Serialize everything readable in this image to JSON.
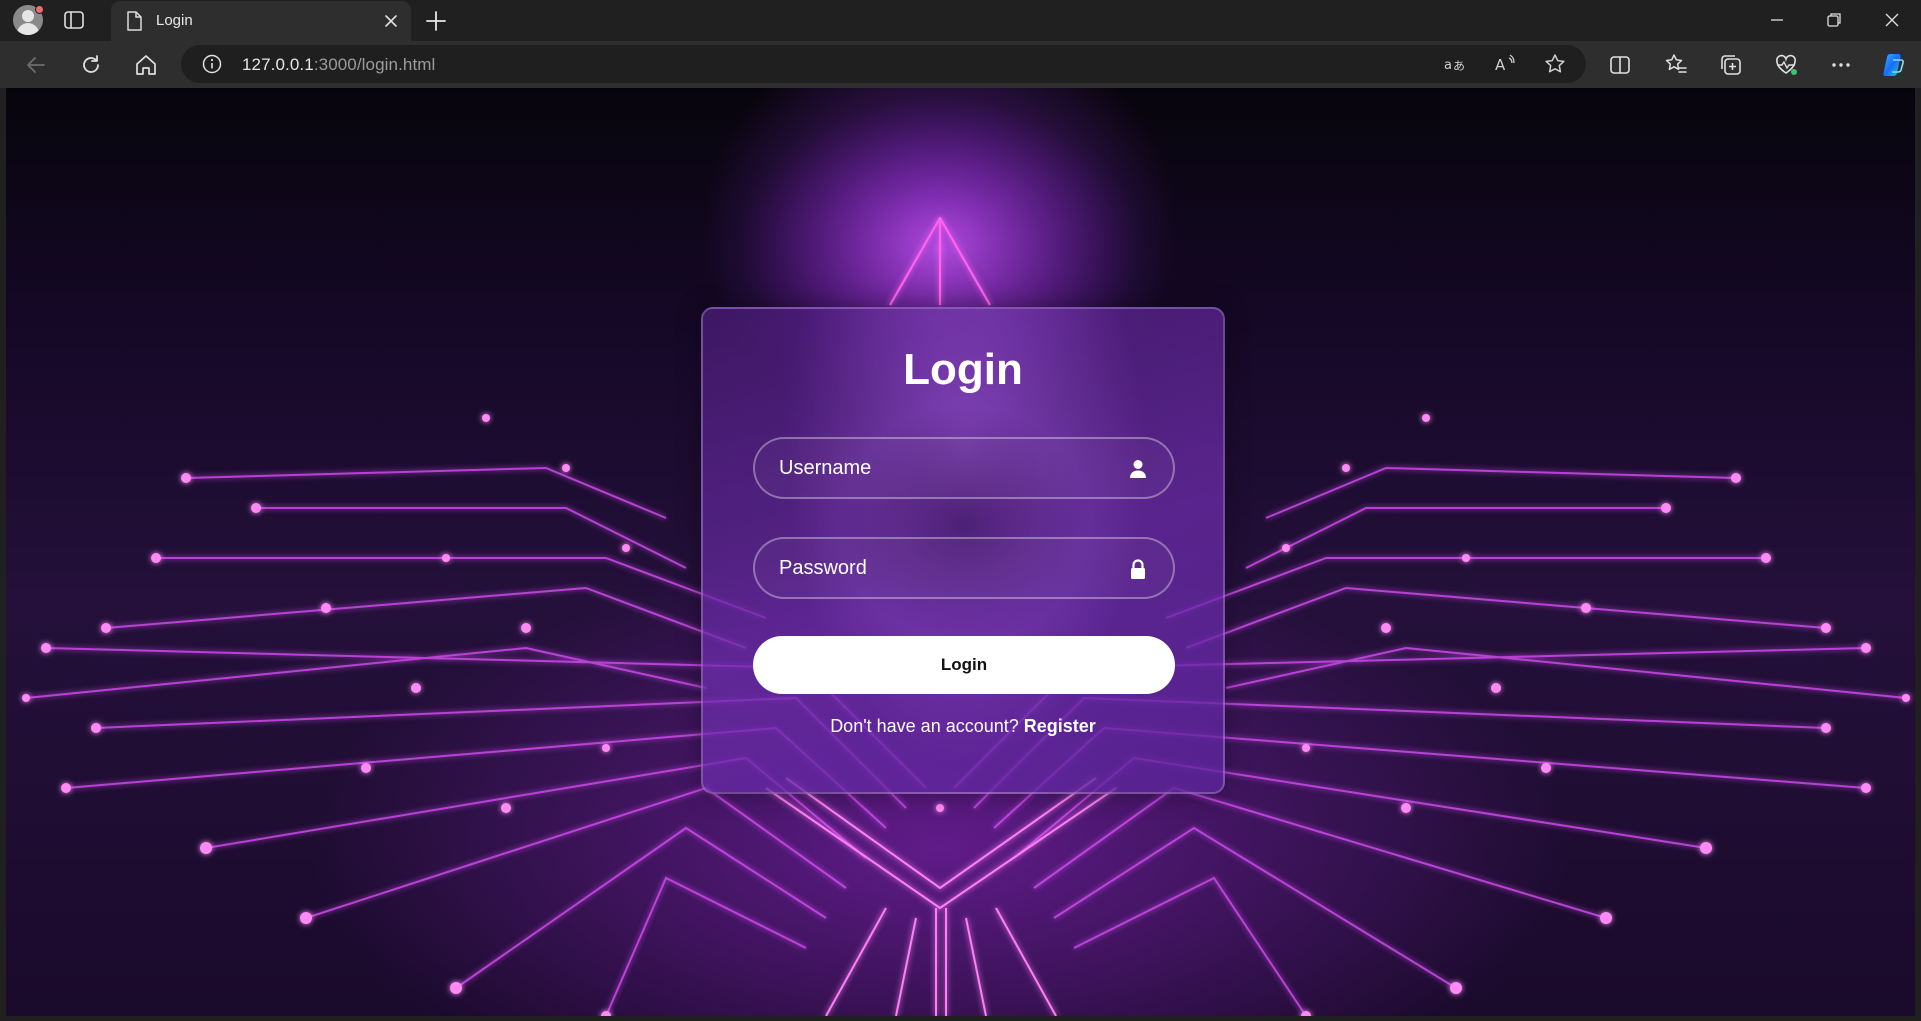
{
  "browser": {
    "tab_title": "Login",
    "url_host": "127.0.0.1",
    "url_rest": ":3000/login.html"
  },
  "icons": {
    "profile": "profile-avatar-icon",
    "tab_actions": "tab-actions-icon",
    "page": "document-icon",
    "close_tab": "close-icon",
    "new_tab": "plus-icon",
    "back": "back-arrow-icon",
    "refresh": "refresh-icon",
    "home": "home-icon",
    "site_info": "info-icon",
    "translate": "translate-icon",
    "read_aloud": "read-aloud-icon",
    "favorite": "star-icon",
    "split_screen": "split-screen-icon",
    "favorites": "favorites-icon",
    "collections": "collections-icon",
    "browser_essentials": "heart-pulse-icon",
    "more": "more-icon",
    "copilot": "copilot-icon",
    "username": "user-icon",
    "password": "lock-icon"
  },
  "colors": {
    "accent": "#b040ff",
    "button_bg": "#ffffff",
    "button_text": "#111111"
  },
  "login": {
    "title": "Login",
    "username_placeholder": "Username",
    "password_placeholder": "Password",
    "button_label": "Login",
    "register_prompt": "Don't have an account?",
    "register_link": "Register"
  }
}
